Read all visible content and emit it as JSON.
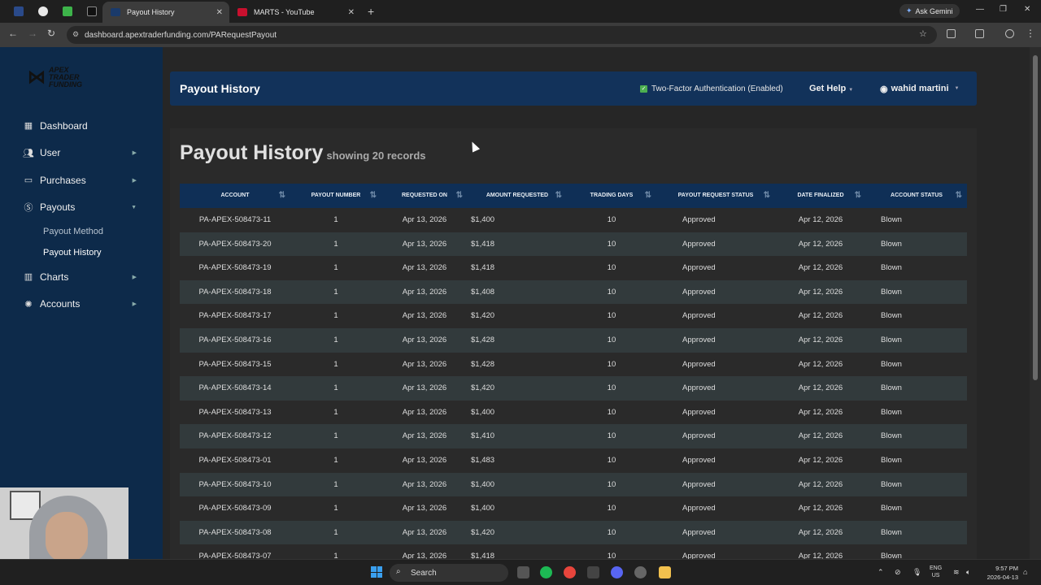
{
  "browser": {
    "tabs": [
      {
        "title": "Payout History",
        "active": true
      },
      {
        "title": "MARTS - YouTube",
        "active": false
      }
    ],
    "ask_gemini": "Ask Gemini",
    "url": "dashboard.apextraderfunding.com/PARequestPayout"
  },
  "sidebar": {
    "logo_text_1": "APEX",
    "logo_text_2": "TRADER",
    "logo_text_3": "FUNDING",
    "items": [
      {
        "label": "Dashboard",
        "icon": "dashboard-icon"
      },
      {
        "label": "User",
        "icon": "users-icon"
      },
      {
        "label": "Purchases",
        "icon": "card-icon"
      },
      {
        "label": "Payouts",
        "icon": "dollar-icon"
      },
      {
        "label": "Charts",
        "icon": "chart-icon"
      },
      {
        "label": "Accounts",
        "icon": "accounts-icon"
      }
    ],
    "payouts_sub": [
      "Payout Method",
      "Payout History"
    ]
  },
  "header": {
    "title": "Payout History",
    "two_factor": "Two-Factor Authentication (Enabled)",
    "get_help": "Get Help",
    "user_name": "wahid martini"
  },
  "content": {
    "title": "Payout History",
    "showing": "showing 20 records"
  },
  "table": {
    "columns": [
      "ACCOUNT",
      "PAYOUT NUMBER",
      "REQUESTED ON",
      "AMOUNT REQUESTED",
      "TRADING DAYS",
      "PAYOUT REQUEST STATUS",
      "DATE FINALIZED",
      "ACCOUNT STATUS"
    ],
    "rows": [
      [
        "PA-APEX-508473-11",
        "1",
        "Apr 13, 2026",
        "$1,400",
        "10",
        "Approved",
        "Apr 12, 2026",
        "Blown"
      ],
      [
        "PA-APEX-508473-20",
        "1",
        "Apr 13, 2026",
        "$1,418",
        "10",
        "Approved",
        "Apr 12, 2026",
        "Blown"
      ],
      [
        "PA-APEX-508473-19",
        "1",
        "Apr 13, 2026",
        "$1,418",
        "10",
        "Approved",
        "Apr 12, 2026",
        "Blown"
      ],
      [
        "PA-APEX-508473-18",
        "1",
        "Apr 13, 2026",
        "$1,408",
        "10",
        "Approved",
        "Apr 12, 2026",
        "Blown"
      ],
      [
        "PA-APEX-508473-17",
        "1",
        "Apr 13, 2026",
        "$1,420",
        "10",
        "Approved",
        "Apr 12, 2026",
        "Blown"
      ],
      [
        "PA-APEX-508473-16",
        "1",
        "Apr 13, 2026",
        "$1,428",
        "10",
        "Approved",
        "Apr 12, 2026",
        "Blown"
      ],
      [
        "PA-APEX-508473-15",
        "1",
        "Apr 13, 2026",
        "$1,428",
        "10",
        "Approved",
        "Apr 12, 2026",
        "Blown"
      ],
      [
        "PA-APEX-508473-14",
        "1",
        "Apr 13, 2026",
        "$1,420",
        "10",
        "Approved",
        "Apr 12, 2026",
        "Blown"
      ],
      [
        "PA-APEX-508473-13",
        "1",
        "Apr 13, 2026",
        "$1,400",
        "10",
        "Approved",
        "Apr 12, 2026",
        "Blown"
      ],
      [
        "PA-APEX-508473-12",
        "1",
        "Apr 13, 2026",
        "$1,410",
        "10",
        "Approved",
        "Apr 12, 2026",
        "Blown"
      ],
      [
        "PA-APEX-508473-01",
        "1",
        "Apr 13, 2026",
        "$1,483",
        "10",
        "Approved",
        "Apr 12, 2026",
        "Blown"
      ],
      [
        "PA-APEX-508473-10",
        "1",
        "Apr 13, 2026",
        "$1,400",
        "10",
        "Approved",
        "Apr 12, 2026",
        "Blown"
      ],
      [
        "PA-APEX-508473-09",
        "1",
        "Apr 13, 2026",
        "$1,400",
        "10",
        "Approved",
        "Apr 12, 2026",
        "Blown"
      ],
      [
        "PA-APEX-508473-08",
        "1",
        "Apr 13, 2026",
        "$1,420",
        "10",
        "Approved",
        "Apr 12, 2026",
        "Blown"
      ],
      [
        "PA-APEX-508473-07",
        "1",
        "Apr 13, 2026",
        "$1,418",
        "10",
        "Approved",
        "Apr 12, 2026",
        "Blown"
      ]
    ]
  },
  "taskbar": {
    "search": "Search",
    "lang_1": "ENG",
    "lang_2": "US",
    "time": "9:57 PM",
    "date": "2026-04-13"
  },
  "colors": {
    "sidebar_bg": "#0d2a4a",
    "header_bg": "#12325a",
    "table_header_bg": "#0f2f56",
    "accent_green": "#4caf50"
  }
}
